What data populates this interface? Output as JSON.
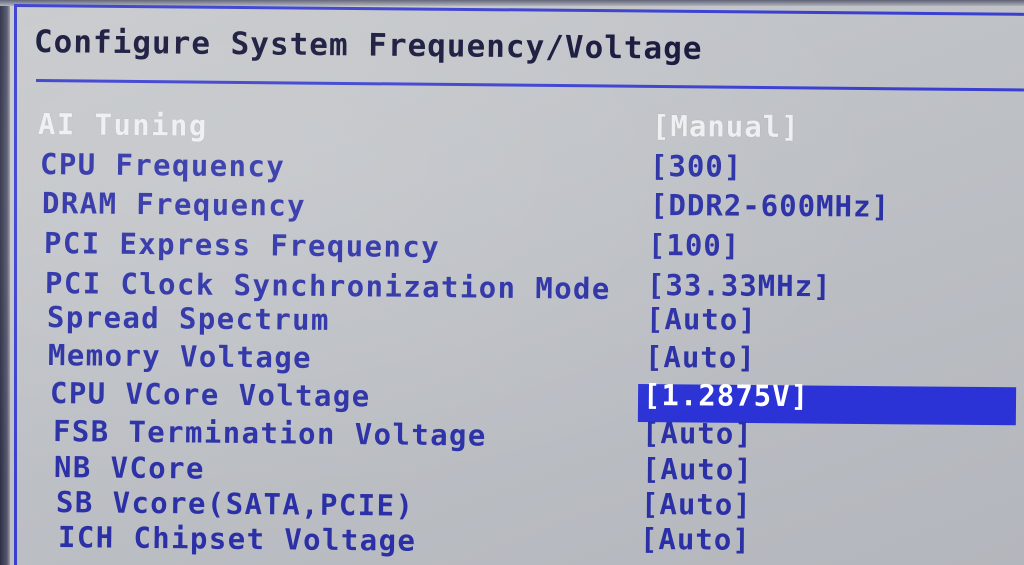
{
  "header": {
    "title": "Configure System Frequency/Voltage"
  },
  "settings": [
    {
      "label": "AI Tuning",
      "value": "[Manual]",
      "state": "disabled"
    },
    {
      "label": "CPU Frequency",
      "value": "[300]",
      "state": "normal"
    },
    {
      "label": "DRAM Frequency",
      "value": "[DDR2-600MHz]",
      "state": "normal"
    },
    {
      "label": "PCI Express Frequency",
      "value": "[100]",
      "state": "normal"
    },
    {
      "label": "PCI Clock Synchronization Mode",
      "value": "[33.33MHz]",
      "state": "normal"
    },
    {
      "label": "Spread Spectrum",
      "value": "[Auto]",
      "state": "normal"
    },
    {
      "label": "Memory Voltage",
      "value": "[Auto]",
      "state": "normal"
    },
    {
      "label": "CPU VCore Voltage",
      "value": "[1.2875V]",
      "state": "selected"
    },
    {
      "label": "FSB Termination Voltage",
      "value": "[Auto]",
      "state": "normal"
    },
    {
      "label": "NB VCore",
      "value": "[Auto]",
      "state": "normal"
    },
    {
      "label": "SB Vcore(SATA,PCIE)",
      "value": "[Auto]",
      "state": "normal"
    },
    {
      "label": "ICH Chipset Voltage",
      "value": "[Auto]",
      "state": "normal"
    }
  ],
  "colors": {
    "text": "#2b30a6",
    "disabled_text": "#eeeff2",
    "highlight": "#2b33d6",
    "frame": "#3a3fd0",
    "background": "#c3c5c9"
  }
}
